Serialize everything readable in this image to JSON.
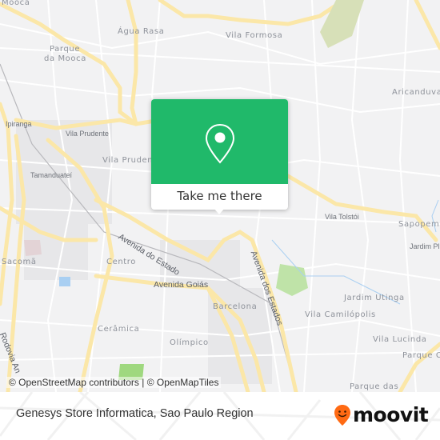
{
  "map": {
    "neighborhoods": [
      {
        "name": "Água Rasa"
      },
      {
        "name": "Vila Formosa"
      },
      {
        "name": "Parque"
      },
      {
        "name": "da Mooca"
      },
      {
        "name": "Mooca"
      },
      {
        "name": "Aricanduva"
      },
      {
        "name": "Vila Prudente"
      },
      {
        "name": "Sacomã"
      },
      {
        "name": "Centro"
      },
      {
        "name": "Barcelona"
      },
      {
        "name": "Cerâmica"
      },
      {
        "name": "Olímpico"
      },
      {
        "name": "Jardim Utinga"
      },
      {
        "name": "Vila Camilópolis"
      },
      {
        "name": "Vila Lucinda"
      },
      {
        "name": "Parque C"
      },
      {
        "name": "Parque das"
      },
      {
        "name": "Sapopemba"
      }
    ],
    "places": [
      {
        "name": "Ipiranga"
      },
      {
        "name": "Vila Prudente"
      },
      {
        "name": "Tamanduateí"
      },
      {
        "name": "Vila Tolstói"
      },
      {
        "name": "Jardim Pl"
      }
    ],
    "roads": [
      {
        "name": "Avenida do Estado"
      },
      {
        "name": "Avenida Goiás"
      },
      {
        "name": "Avenida dos Estados"
      },
      {
        "name": "Rodovia An"
      }
    ],
    "colors": {
      "background": "#f2f2f3",
      "street": "#ffffff",
      "major_road": "#fbe7a8",
      "park": "#b9e3a1",
      "water": "#a9cff2"
    }
  },
  "popup": {
    "icon": "location-pin-icon",
    "button_label": "Take me there",
    "color": "#20b96a"
  },
  "attribution": "© OpenStreetMap contributors | © OpenMapTiles",
  "footer": {
    "place_title": "Genesys Store Informatica, Sao Paulo Region",
    "brand": "moovit",
    "brand_color": "#ff6a13"
  }
}
